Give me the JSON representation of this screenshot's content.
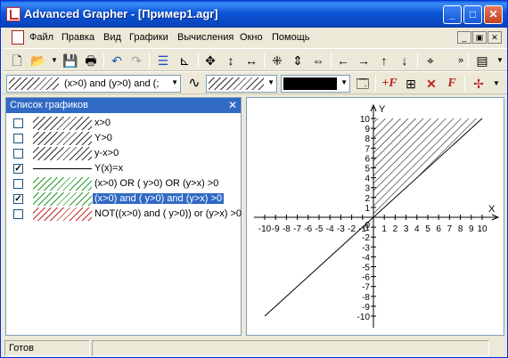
{
  "window": {
    "title": "Advanced Grapher - [Пример1.agr]",
    "controls": {
      "minimize": "_",
      "maximize": "□",
      "close": "✕"
    }
  },
  "menu": {
    "items": [
      "Файл",
      "Правка",
      "Вид",
      "Графики",
      "Вычисления",
      "Окно",
      "Помощь"
    ],
    "mdi": {
      "minimize": "_",
      "restore": "▣",
      "close": "✕"
    }
  },
  "toolbar1": {
    "icons": [
      "new-icon",
      "open-icon",
      "save-icon",
      "print-icon",
      "undo-icon",
      "redo-icon",
      "list-icon",
      "axes-icon",
      "move-icon",
      "vertical-icon",
      "horizontal-icon",
      "zoom-in-icon",
      "zoom-in-v-icon",
      "zoom-in-h-icon",
      "arrow-left-icon",
      "arrow-right-icon",
      "arrow-up-icon",
      "arrow-down-icon",
      "center-icon",
      "more-icon",
      "view-icon"
    ]
  },
  "toolbar2": {
    "graph_combo": "(x>0) and (y>0)  and  (;",
    "line_style": "∿"
  },
  "graph_list": {
    "title": "Список графиков",
    "close": "✕",
    "items": [
      {
        "label": "x>0",
        "checked": false,
        "swatch": "hatch"
      },
      {
        "label": "Y>0",
        "checked": false,
        "swatch": "hatch"
      },
      {
        "label": "y-x>0",
        "checked": false,
        "swatch": "hatch"
      },
      {
        "label": "Y(x)=x",
        "checked": true,
        "swatch": "line"
      },
      {
        "label": "(x>0) OR ( y>0)  OR  (y>x)  >0",
        "checked": false,
        "swatch": "hatch-green"
      },
      {
        "label": "(x>0) and ( y>0)  and  (y>x)  >0",
        "checked": true,
        "swatch": "hatch-green",
        "selected": true
      },
      {
        "label": "NOT((x>0) and ( y>0))  or  (y>x)  >0",
        "checked": false,
        "swatch": "hatch-red"
      }
    ]
  },
  "graph": {
    "x_axis_label": "X",
    "y_axis_label": "Y",
    "x_ticks": [
      "-10",
      "-9",
      "-8",
      "-7",
      "-6",
      "-5",
      "-4",
      "-3",
      "-2",
      "-1",
      "1",
      "2",
      "3",
      "4",
      "5",
      "6",
      "7",
      "8",
      "9",
      "10"
    ],
    "y_ticks": [
      "10",
      "9",
      "8",
      "7",
      "6",
      "5",
      "4",
      "3",
      "2",
      "1",
      "-1",
      "-2",
      "-3",
      "-4",
      "-5",
      "-6",
      "-7",
      "-8",
      "-9",
      "-10"
    ],
    "origin_label": "0"
  },
  "chart_data": {
    "type": "line",
    "xlim": [
      -10,
      10
    ],
    "ylim": [
      -10,
      10
    ],
    "series": [
      {
        "name": "Y(x)=x",
        "x": [
          -10,
          10
        ],
        "y": [
          -10,
          10
        ]
      }
    ],
    "shaded_region": "(x>0) and ( y>0)  and  (y>x)  >0"
  },
  "status": {
    "text": "Готов"
  }
}
